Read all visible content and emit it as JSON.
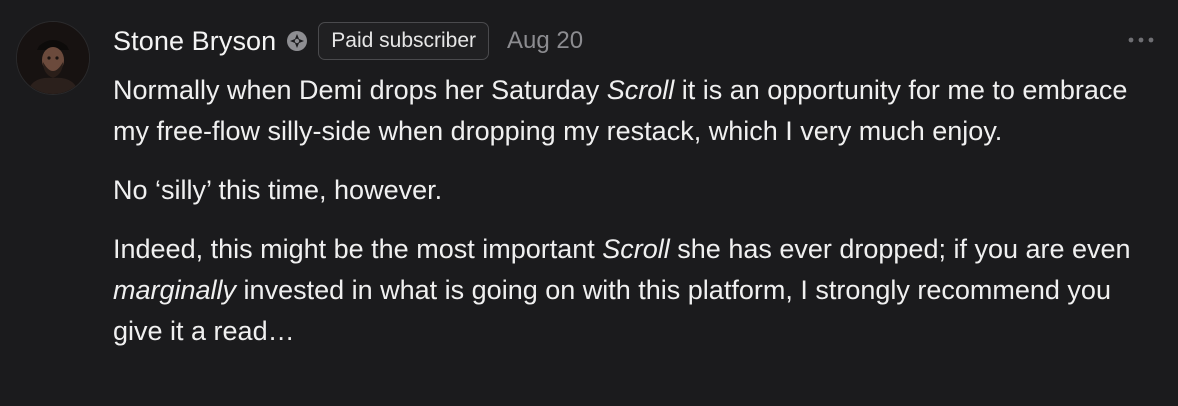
{
  "comment": {
    "author": "Stone Bryson",
    "badge_label": "Paid subscriber",
    "date": "Aug 20",
    "author_badge_icon": "substack-badge-icon",
    "more_icon": "ellipsis-icon",
    "paragraphs": [
      {
        "p1_a": "Normally when Demi drops her Saturday ",
        "p1_em": "Scroll",
        "p1_b": " it is an opportunity for me to embrace my free-flow silly-side when dropping my restack, which I very much enjoy."
      },
      {
        "p2": "No ‘silly’ this time, however."
      },
      {
        "p3_a": "Indeed, this might be the most important ",
        "p3_em1": "Scroll",
        "p3_b": " she has ever dropped; if you are even ",
        "p3_em2": "marginally",
        "p3_c": " invested in what is going on with this platform, I strongly recommend you give it a read…"
      }
    ]
  },
  "colors": {
    "background": "#1b1b1d",
    "text": "#f0f0f0",
    "muted": "#8c8c90",
    "badge_border": "#4a4a4d"
  }
}
